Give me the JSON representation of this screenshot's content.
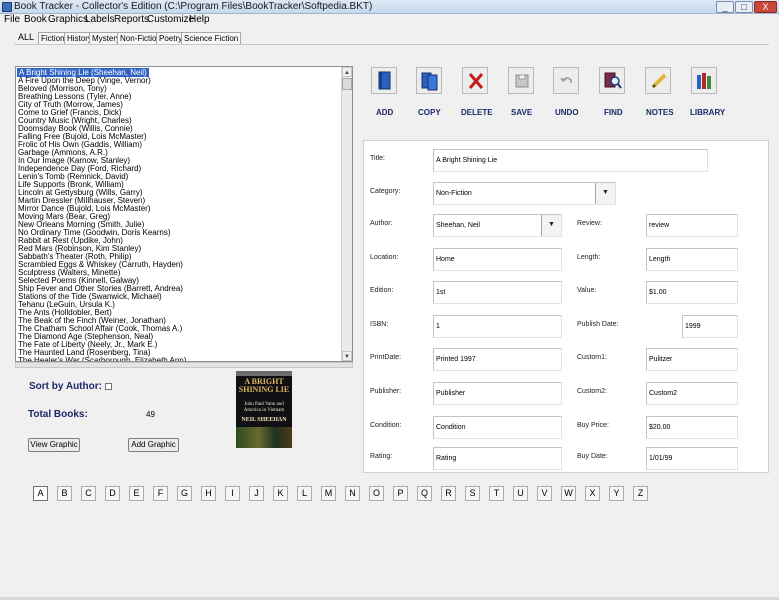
{
  "window": {
    "title": "Book Tracker - Collector's Edition      (C:\\Program Files\\BookTracker\\Softpedia.BKT)",
    "min_glyph": "_",
    "max_glyph": "□",
    "close_glyph": "X"
  },
  "menu": [
    "File",
    "Book",
    "Graphics",
    "Labels",
    "Reports",
    "Customize",
    "Help"
  ],
  "tabs": [
    "ALL",
    "Fiction",
    "History",
    "Mystery",
    "Non-Fiction",
    "Poetry",
    "Science Fiction"
  ],
  "books": [
    "A Bright Shining Lie (Sheehan, Neil)",
    "A Fire Upon the Deep (Vinge, Vernor)",
    "Beloved (Morrison, Tony)",
    "Breathing Lessons (Tyler, Anne)",
    "City of Truth (Morrow, James)",
    "Come to Grief (Francis, Dick)",
    "Country Music (Wright, Charles)",
    "Doomsday Book (Willis, Connie)",
    "Falling Free (Bujold, Lois McMaster)",
    "Frolic of His Own (Gaddis, William)",
    "Garbage (Ammons, A.R.)",
    "In Our Image (Karnow, Stanley)",
    "Independence Day (Ford, Richard)",
    "Lenin's Tomb (Remnick, David)",
    "Life Supports (Bronk, William)",
    "Lincoln at Gettysburg (Wills, Garry)",
    "Martin Dressler (Millhauser, Steven)",
    "Mirror Dance (Bujold, Lois McMaster)",
    "Moving Mars (Bear, Greg)",
    "New Orleans Morning (Smith, Julie)",
    "No Ordinary Time (Goodwin, Doris Kearns)",
    "Rabbit at Rest (Updike, John)",
    "Red Mars (Robinson, Kim Stanley)",
    "Sabbath's Theater (Roth, Philip)",
    "Scrambled Eggs & Whiskey (Carruth, Hayden)",
    "Sculptress (Walters, Minette)",
    "Selected Poems (Kinnell, Galway)",
    "Ship Fever and Other Stories (Barrett, Andrea)",
    "Stations of the Tide (Swanwick, Michael)",
    "Tehanu (LeGuin, Ursula K.)",
    "The Ants (Holldobler, Bert)",
    "The Beak of the Finch (Weiner, Jonathan)",
    "The Chatham School Affair (Cook, Thomas A.)",
    "The Diamond Age (Stephenson, Neal)",
    "The Fate of Liberty (Neely, Jr., Mark E.)",
    "The Haunted Land (Rosenberg, Tina)",
    "The Healer's War (Scarborough, Elizabeth Ann)"
  ],
  "sort": {
    "label": "Sort by Author:",
    "checked": false
  },
  "total": {
    "label": "Total Books:",
    "value": "49"
  },
  "buttons": {
    "view_graphic": "View Graphic",
    "add_graphic": "Add Graphic"
  },
  "cover": {
    "title": "A BRIGHT SHINING LIE",
    "subtitle": "John Paul Vann and America in Vietnam",
    "author": "NEIL SHEEHAN"
  },
  "toolbar": {
    "add": "ADD",
    "copy": "COPY",
    "delete": "DELETE",
    "save": "SAVE",
    "undo": "UNDO",
    "find": "FIND",
    "notes": "NOTES",
    "library": "LIBRARY"
  },
  "labels": {
    "title": "Title:",
    "category": "Category:",
    "author": "Author:",
    "review": "Review:",
    "location": "Location:",
    "length": "Length:",
    "edition": "Edition:",
    "value": "Value:",
    "isbn": "ISBN:",
    "publish_date": "Publish Date:",
    "print_date": "PrintDate:",
    "custom1": "Custom1:",
    "publisher": "Publisher:",
    "custom2": "Custom2:",
    "condition": "Condition:",
    "buy_price": "Buy Price:",
    "rating": "Rating:",
    "buy_date": "Buy Date:"
  },
  "values": {
    "title": "A Bright Shining Lie",
    "category": "Non-Fiction",
    "author": "Sheehan, Neil",
    "review": "review",
    "location": "Home",
    "length": "Length",
    "edition": "1st",
    "value": "$1.00",
    "isbn": "1",
    "publish_date": "1999",
    "print_date": "Printed 1997",
    "custom1": "Pulitzer",
    "publisher": "Publisher",
    "custom2": "Custom2",
    "condition": "Condition",
    "buy_price": "$20.00",
    "rating": "Rating",
    "buy_date": "1/01/99"
  },
  "alphabet": [
    "A",
    "B",
    "C",
    "D",
    "E",
    "F",
    "G",
    "H",
    "I",
    "J",
    "K",
    "L",
    "M",
    "N",
    "O",
    "P",
    "Q",
    "R",
    "S",
    "T",
    "U",
    "V",
    "W",
    "X",
    "Y",
    "Z"
  ],
  "colors": {
    "selection": "#3064c4",
    "label_blue": "#1c2a6a"
  }
}
